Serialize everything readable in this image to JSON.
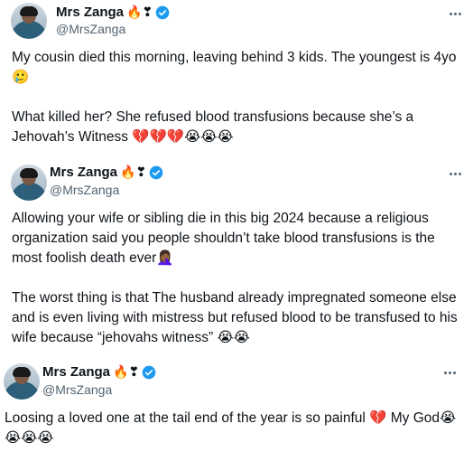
{
  "tweets": [
    {
      "name": "Mrs Zanga",
      "name_emojis": "🔥❣",
      "handle": "@MrsZanga",
      "lines": [
        "My cousin died this morning, leaving behind 3 kids. The youngest is 4yo",
        "🥲",
        "",
        "What killed her? She refused blood transfusions because she’s a",
        "Jehovah’s Witness 💔💔💔😭😭😭"
      ]
    },
    {
      "name": "Mrs Zanga",
      "name_emojis": "🔥❣",
      "handle": "@MrsZanga",
      "lines": [
        "Allowing your wife or sibling die in this big 2024 because a religious",
        "organization said you people shouldn’t take blood transfusions is the",
        "most foolish death ever🤦🏾‍♀️",
        "",
        "The worst thing is that The husband already impregnated someone else",
        "and is even living with mistress but refused blood to be transfused to his",
        "wife because “jehovahs witness” 😭😭"
      ]
    },
    {
      "name": "Mrs Zanga",
      "name_emojis": "🔥❣",
      "handle": "@MrsZanga",
      "lines": [
        "Loosing a loved one at the tail end of the year is so painful 💔 My God😭",
        "😭😭😭"
      ]
    }
  ],
  "colors": {
    "verified": "#1d9bf0",
    "handle": "#536471",
    "text": "#0f1419"
  },
  "icons": {
    "verified": "verified-badge-icon",
    "more": "more-options-icon"
  }
}
